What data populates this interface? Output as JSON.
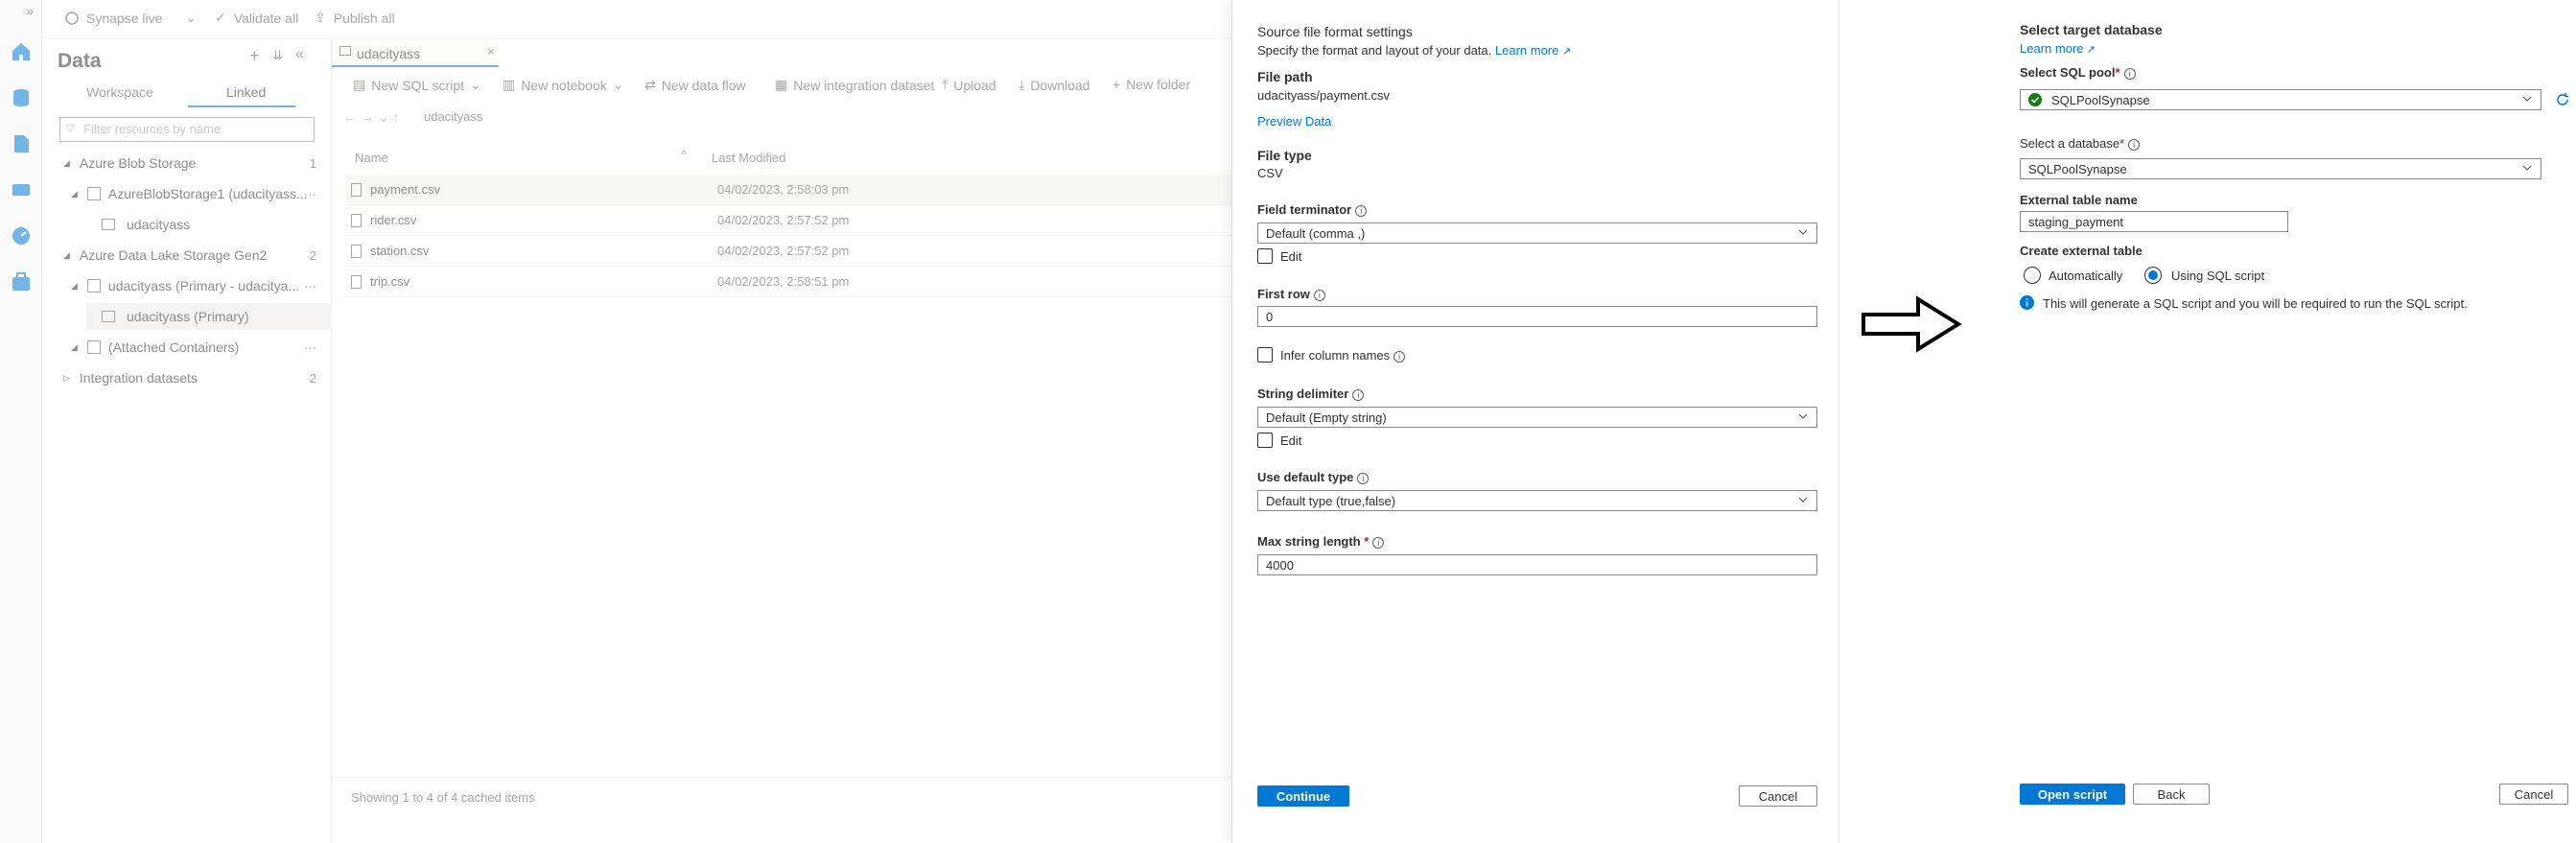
{
  "topbar": {
    "workspace": "Synapse live",
    "validate_all": "Validate all",
    "publish_all": "Publish all"
  },
  "data_panel": {
    "title": "Data",
    "tabs": [
      "Workspace",
      "Linked"
    ],
    "filter_placeholder": "Filter resources by name",
    "tree": [
      {
        "label": "Azure Blob Storage",
        "count": "1"
      },
      {
        "label": "AzureBlobStorage1 (udacityass...",
        "more": "···"
      },
      {
        "label": "udacityass"
      },
      {
        "label": "Azure Data Lake Storage Gen2",
        "count": "2"
      },
      {
        "label": "udacityass (Primary - udacitya...",
        "more": "···"
      },
      {
        "label": "udacityass (Primary)"
      },
      {
        "label": "(Attached Containers)",
        "more": "···"
      },
      {
        "label": "Integration datasets",
        "count": "2"
      }
    ]
  },
  "file_pane": {
    "tab": "udacityass",
    "toolbar": [
      "New SQL script",
      "New notebook",
      "New data flow",
      "New integration dataset",
      "Upload",
      "Download",
      "New folder"
    ],
    "path": "udacityass",
    "columns": [
      "Name",
      "Last Modified"
    ],
    "rows": [
      {
        "name": "payment.csv",
        "modified": "04/02/2023, 2:58:03 pm"
      },
      {
        "name": "rider.csv",
        "modified": "04/02/2023, 2:57:52 pm"
      },
      {
        "name": "station.csv",
        "modified": "04/02/2023, 2:57:52 pm"
      },
      {
        "name": "trip.csv",
        "modified": "04/02/2023, 2:58:51 pm"
      }
    ],
    "status": "Showing 1 to 4 of 4 cached items"
  },
  "blade": {
    "title": "Source file format settings",
    "subtitle": "Specify the format and layout of your data.",
    "learn_more": "Learn more",
    "file_path_label": "File path",
    "file_path": "udacityass/payment.csv",
    "preview": "Preview Data",
    "file_type_label": "File type",
    "file_type": "CSV",
    "field_terminator_label": "Field terminator",
    "field_terminator": "Default (comma ,)",
    "edit": "Edit",
    "first_row_label": "First row",
    "first_row": "0",
    "infer_label": "Infer column names",
    "string_delim_label": "String delimiter",
    "string_delim": "Default (Empty string)",
    "default_type_label": "Use default type",
    "default_type": "Default type (true,false)",
    "max_len_label": "Max string length",
    "max_len_required": "*",
    "max_len": "4000",
    "continue": "Continue",
    "cancel": "Cancel"
  },
  "target": {
    "title": "Select target database",
    "learn_more": "Learn more",
    "sql_pool_label": "Select SQL pool",
    "sql_pool": "SQLPoolSynapse",
    "database_label": "Select a database",
    "database": "SQLPoolSynapse",
    "required": "*",
    "ext_table_label": "External table name",
    "ext_table": "staging_payment",
    "create_label": "Create external table",
    "opt_auto": "Automatically",
    "opt_script": "Using SQL script",
    "info_text": "This will generate a SQL script and you will be required to run the SQL script.",
    "open_script": "Open script",
    "back": "Back",
    "cancel": "Cancel"
  },
  "colors": {
    "accent": "#0078d4",
    "success": "#107c10"
  }
}
